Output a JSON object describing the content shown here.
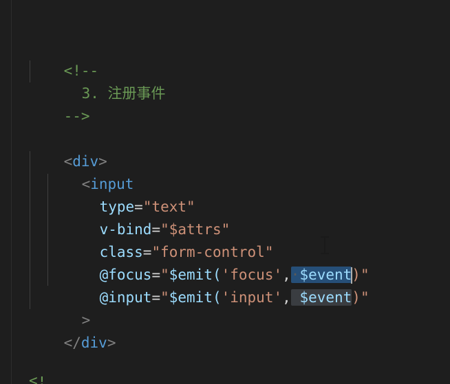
{
  "code": {
    "lines": [
      {
        "comment_open": "<!--"
      },
      {
        "comment_text": "3. 注册事件"
      },
      {
        "comment_close": "-->"
      },
      {
        "open_lt": "<",
        "open_tag": "div",
        "open_gt": ">"
      },
      {
        "input_lt": "<",
        "input_tag": "input"
      },
      {
        "attr": "type",
        "eq": "=",
        "val": "\"text\""
      },
      {
        "attr": "v-bind",
        "eq": "=",
        "val": "\"$attrs\""
      },
      {
        "attr": "class",
        "eq": "=",
        "val": "\"form-control\""
      },
      {
        "attr": "@focus",
        "eq": "=",
        "val_open": "\"",
        "call": "$emit(",
        "arg1": "'focus'",
        "comma": ",",
        "space_dot": "·",
        "arg2_a": "$event",
        "close": ")\""
      },
      {
        "attr": "@input",
        "eq": "=",
        "val_open": "\"",
        "call": "$emit(",
        "arg1": "'input'",
        "comma": ",",
        "space": " ",
        "arg2": "$event",
        "close": ")\""
      },
      {
        "gt": ">"
      },
      {
        "close_lt": "</",
        "close_tag": "div",
        "close_gt": ">"
      }
    ],
    "bottom_fragment": "<!"
  },
  "colors": {
    "background": "#1e1e1e",
    "comment": "#6a9955",
    "tag": "#569cd6",
    "attribute": "#9cdcfe",
    "string": "#ce9178",
    "punctuation": "#808080",
    "selection": "#264f78",
    "selection_highlight": "#3a3d41"
  },
  "cursor": {
    "type": "text-ibeam"
  }
}
